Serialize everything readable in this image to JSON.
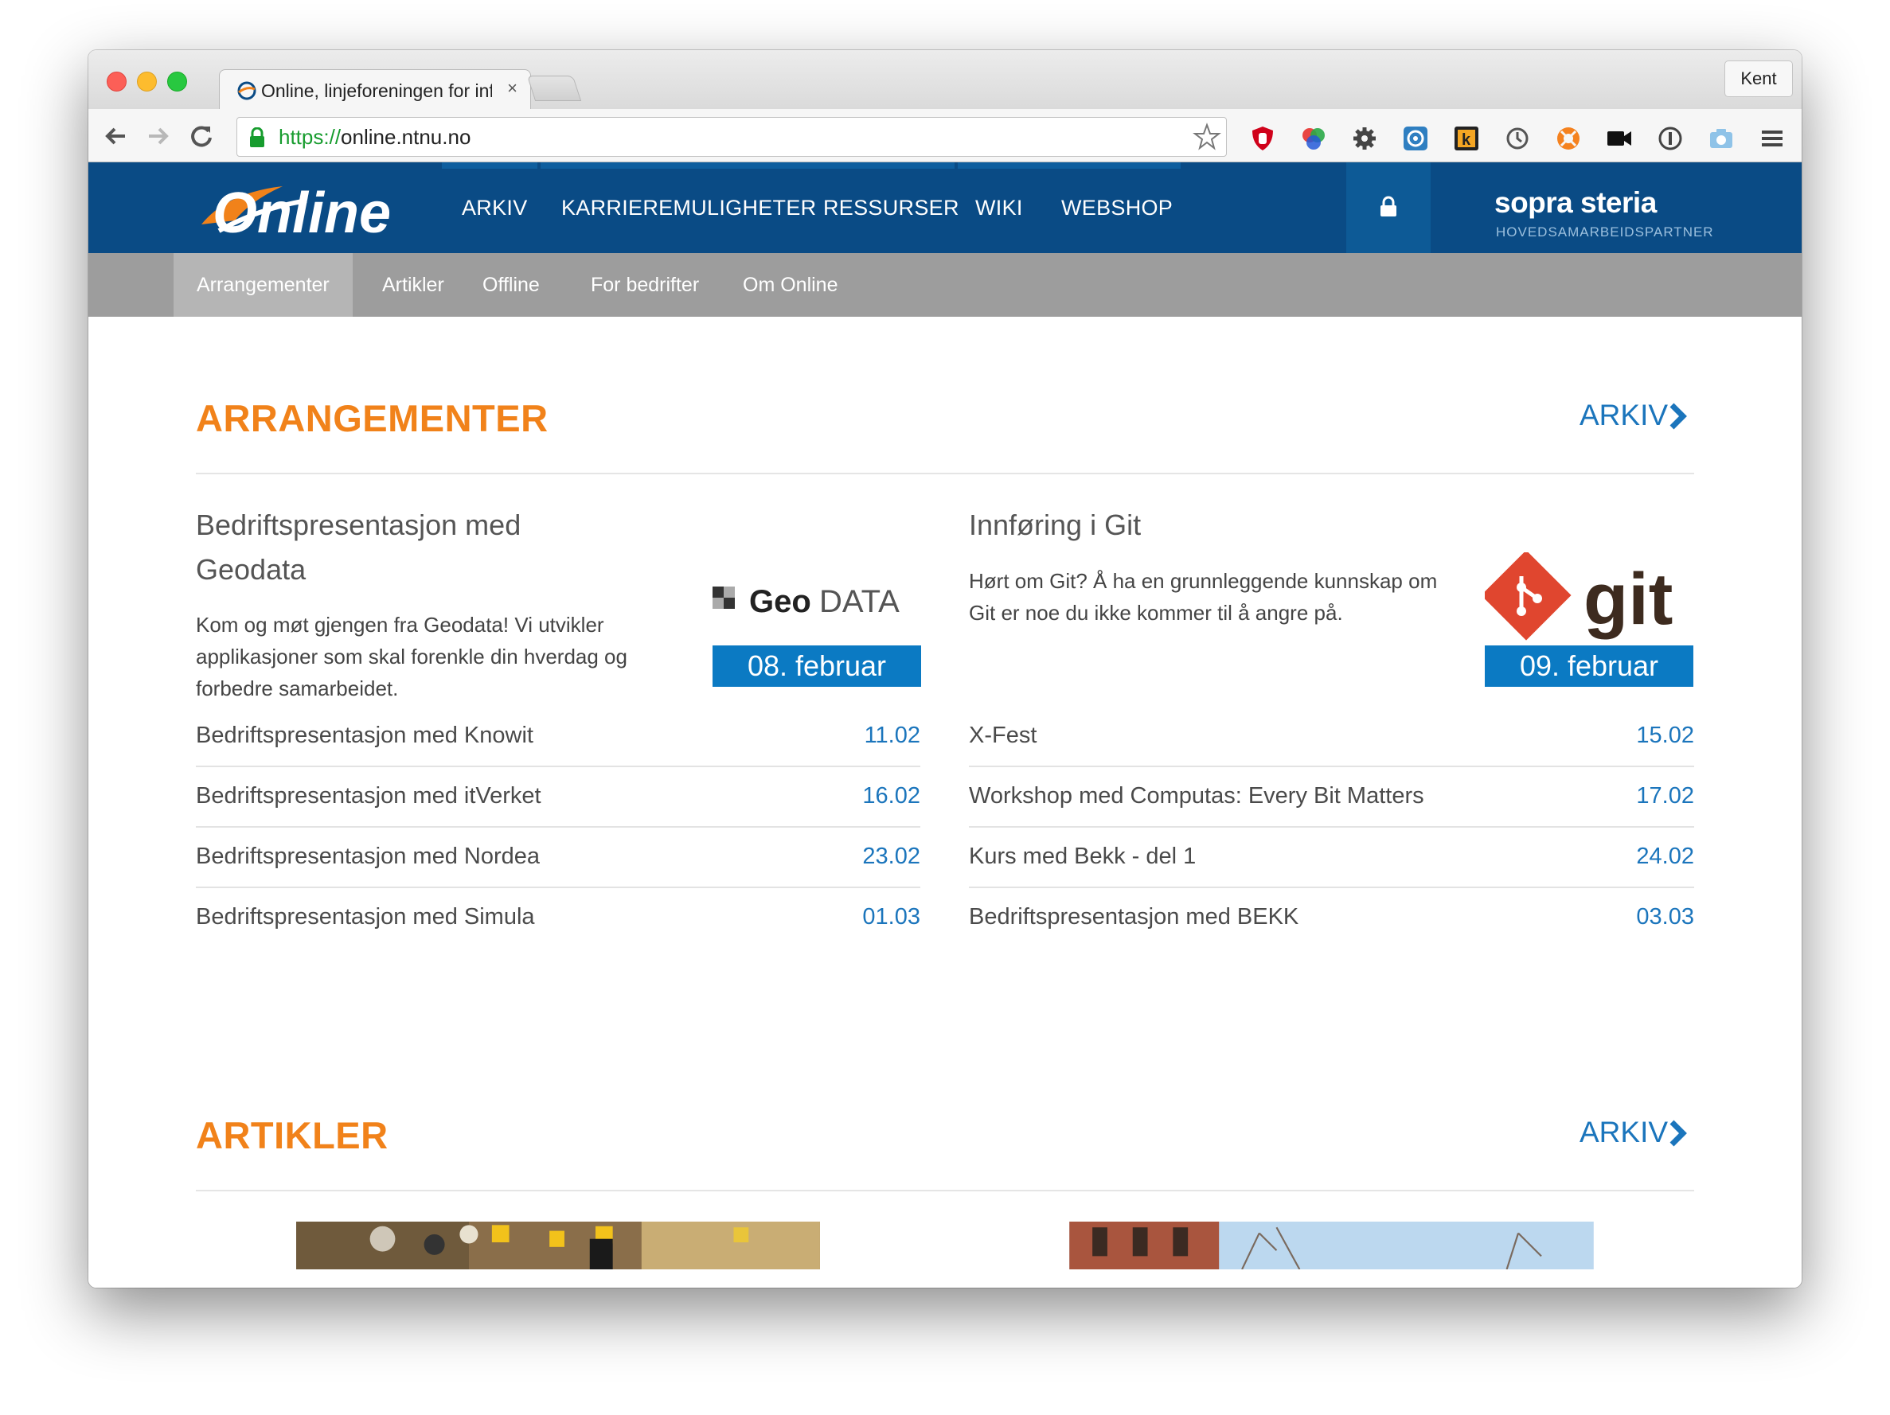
{
  "browser": {
    "tab_title": "Online, linjeforeningen for informatikk",
    "tab_close": "×",
    "profile_name": "Kent",
    "url_scheme": "https://",
    "url_rest": "online.ntnu.no",
    "extensions": [
      "ublock-icon",
      "color-picker-icon",
      "gear-icon",
      "screenshot-icon",
      "k-icon",
      "sync-icon",
      "lifebuoy-icon",
      "video-icon",
      "1password-icon",
      "camera-icon",
      "menu-icon"
    ]
  },
  "site": {
    "logo_text": "Online",
    "nav": [
      "ARKIV",
      "KARRIEREMULIGHETER",
      "RESSURSER",
      "WIKI",
      "WEBSHOP"
    ],
    "partner_brand": "sopra steria",
    "partner_sub": "HOVEDSAMARBEIDSPARTNER",
    "subnav": [
      "Arrangementer",
      "Artikler",
      "Offline",
      "For bedrifter",
      "Om Online"
    ],
    "colors": {
      "nav_blue": "#0a4b85",
      "accent_orange": "#f1821a",
      "link_blue": "#1b75bc",
      "badge_blue": "#0b7ac3"
    }
  },
  "events": {
    "title": "ARRANGEMENTER",
    "archive": "ARKIV",
    "featured": [
      {
        "title": "Bedriftspresentasjon med Geodata",
        "desc": "Kom og møt gjengen fra Geodata! Vi utvikler applikasjoner som skal forenkle din hverdag og forbedre samarbeidet.",
        "logo_text_a": "Geo",
        "logo_text_b": "DATA",
        "date": "08. februar"
      },
      {
        "title": "Innføring i Git",
        "desc": "Hørt om Git? Å ha en grunnleggende kunnskap om Git er noe du ikke kommer til å angre på.",
        "logo_text": "git",
        "date": "09. februar"
      }
    ],
    "list_left": [
      {
        "name": "Bedriftspresentasjon med Knowit",
        "date": "11.02"
      },
      {
        "name": "Bedriftspresentasjon med itVerket",
        "date": "16.02"
      },
      {
        "name": "Bedriftspresentasjon med Nordea",
        "date": "23.02"
      },
      {
        "name": "Bedriftspresentasjon med Simula",
        "date": "01.03"
      }
    ],
    "list_right": [
      {
        "name": "X-Fest",
        "date": "15.02"
      },
      {
        "name": "Workshop med Computas: Every Bit Matters",
        "date": "17.02"
      },
      {
        "name": "Kurs med Bekk - del 1",
        "date": "24.02"
      },
      {
        "name": "Bedriftspresentasjon med BEKK",
        "date": "03.03"
      }
    ]
  },
  "articles": {
    "title": "ARTIKLER",
    "archive": "ARKIV"
  }
}
